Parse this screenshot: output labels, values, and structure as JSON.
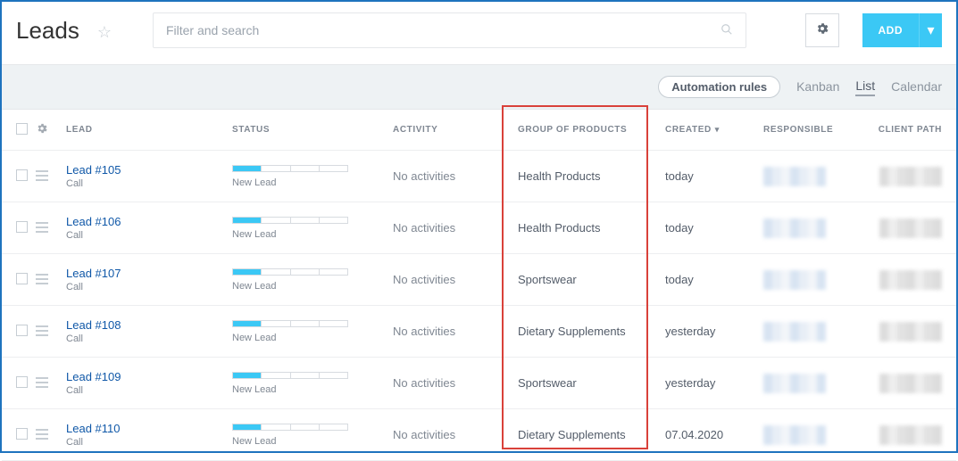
{
  "header": {
    "title": "Leads",
    "search_placeholder": "Filter and search",
    "add_label": "ADD"
  },
  "toolbar": {
    "automation_rules": "Automation rules",
    "views": {
      "kanban": "Kanban",
      "list": "List",
      "calendar": "Calendar"
    }
  },
  "columns": {
    "lead": "LEAD",
    "status": "STATUS",
    "activity": "ACTIVITY",
    "group": "GROUP OF PRODUCTS",
    "created": "CREATED",
    "responsible": "RESPONSIBLE",
    "client_path": "CLIENT PATH"
  },
  "rows": [
    {
      "lead": "Lead #105",
      "sub": "Call",
      "status": "New Lead",
      "activity": "No activities",
      "group": "Health Products",
      "created": "today"
    },
    {
      "lead": "Lead #106",
      "sub": "Call",
      "status": "New Lead",
      "activity": "No activities",
      "group": "Health Products",
      "created": "today"
    },
    {
      "lead": "Lead #107",
      "sub": "Call",
      "status": "New Lead",
      "activity": "No activities",
      "group": "Sportswear",
      "created": "today"
    },
    {
      "lead": "Lead #108",
      "sub": "Call",
      "status": "New Lead",
      "activity": "No activities",
      "group": "Dietary Supplements",
      "created": "yesterday"
    },
    {
      "lead": "Lead #109",
      "sub": "Call",
      "status": "New Lead",
      "activity": "No activities",
      "group": "Sportswear",
      "created": "yesterday"
    },
    {
      "lead": "Lead #110",
      "sub": "Call",
      "status": "New Lead",
      "activity": "No activities",
      "group": "Dietary Supplements",
      "created": "07.04.2020"
    }
  ]
}
